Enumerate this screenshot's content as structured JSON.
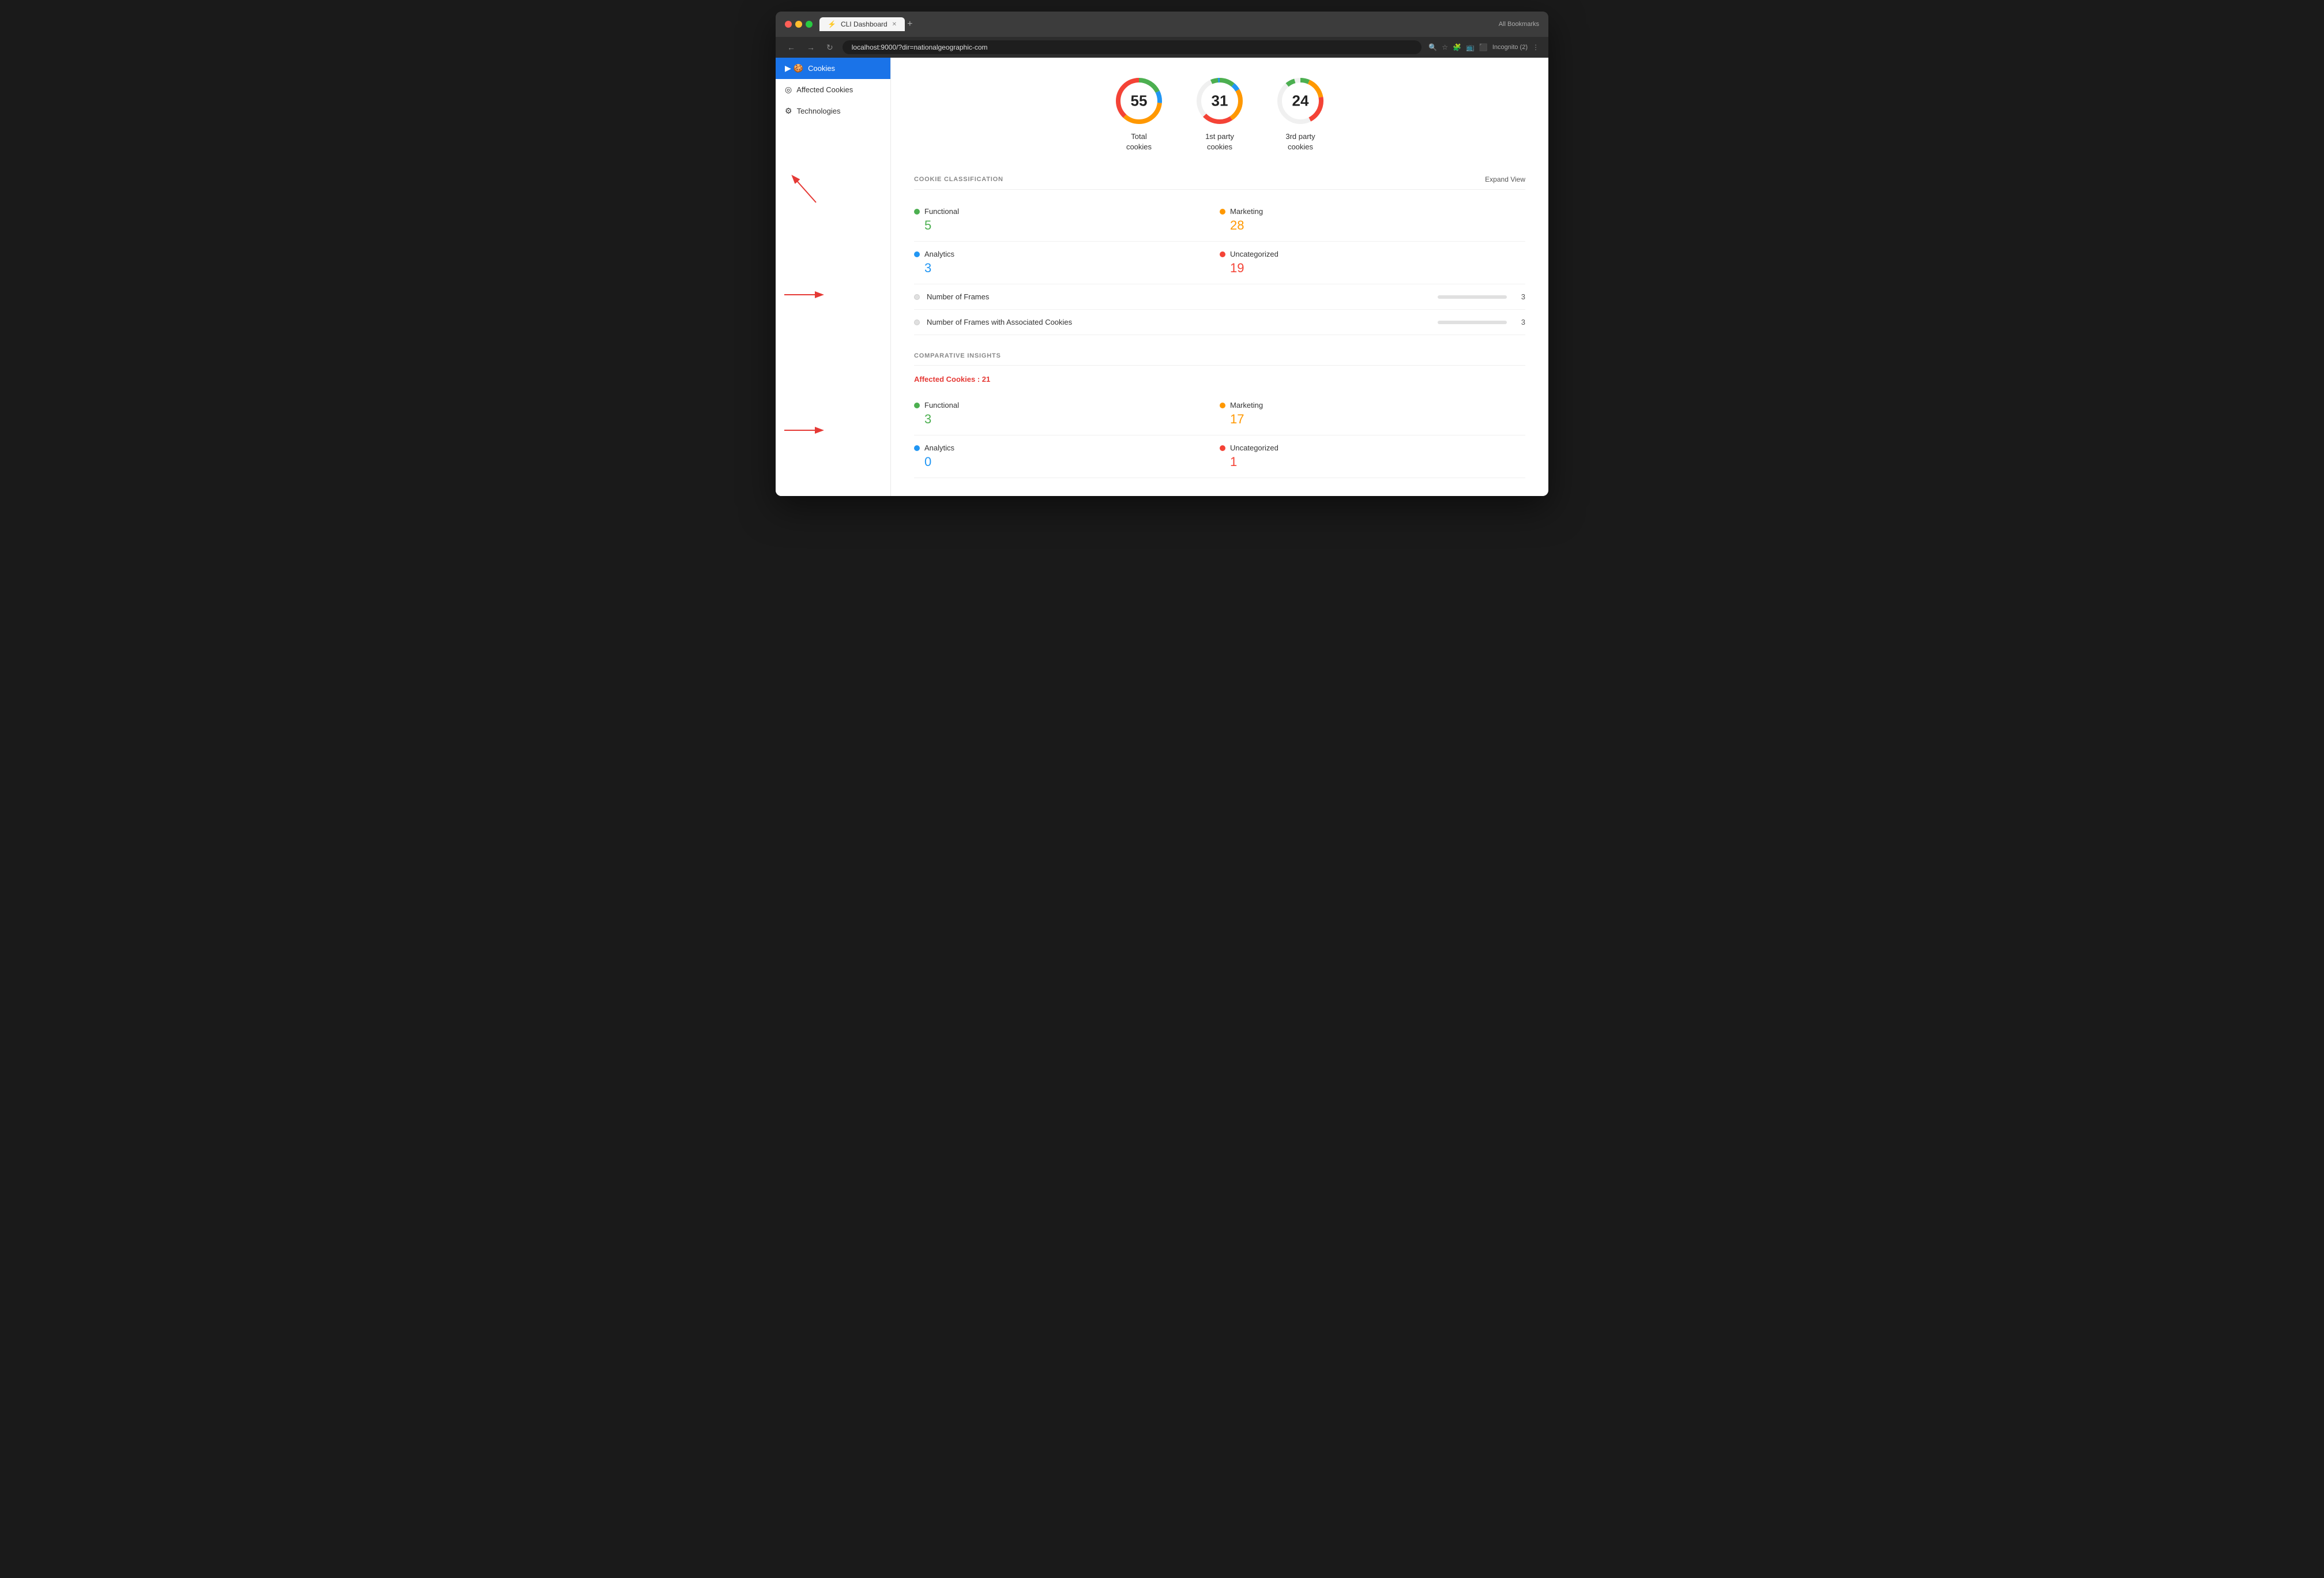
{
  "browser": {
    "tab_title": "CLI Dashboard",
    "url": "localhost:9000/?dir=nationalgeographic-com",
    "incognito_label": "Incognito (2)",
    "bookmarks_label": "All Bookmarks",
    "nav_add": "+"
  },
  "sidebar": {
    "items": [
      {
        "id": "cookies",
        "label": "Cookies",
        "icon": "🍪",
        "active": true,
        "expandable": true
      },
      {
        "id": "affected-cookies",
        "label": "Affected Cookies",
        "icon": "◎",
        "active": false
      },
      {
        "id": "technologies",
        "label": "Technologies",
        "icon": "⚙",
        "active": false
      }
    ]
  },
  "charts": [
    {
      "id": "total",
      "value": "55",
      "title": "Total\ncookies",
      "pct": 100
    },
    {
      "id": "first-party",
      "value": "31",
      "title": "1st party\ncookies",
      "pct": 56
    },
    {
      "id": "third-party",
      "value": "24",
      "title": "3rd party\ncookies",
      "pct": 44
    }
  ],
  "cookie_classification": {
    "section_title": "COOKIE CLASSIFICATION",
    "expand_label": "Expand View",
    "items": [
      {
        "id": "functional",
        "label": "Functional",
        "value": "5",
        "color_class": "dot-green",
        "val_class": "val-green"
      },
      {
        "id": "marketing",
        "label": "Marketing",
        "value": "28",
        "color_class": "dot-orange",
        "val_class": "val-orange"
      },
      {
        "id": "analytics",
        "label": "Analytics",
        "value": "3",
        "color_class": "dot-blue",
        "val_class": "val-blue"
      },
      {
        "id": "uncategorized",
        "label": "Uncategorized",
        "value": "19",
        "color_class": "dot-red",
        "val_class": "val-red"
      }
    ],
    "frames": [
      {
        "id": "num-frames",
        "label": "Number of Frames",
        "value": "3"
      },
      {
        "id": "num-frames-cookies",
        "label": "Number of Frames with Associated Cookies",
        "value": "3"
      }
    ]
  },
  "comparative_insights": {
    "section_title": "COMPARATIVE INSIGHTS",
    "affected_label": "Affected Cookies : 21",
    "items": [
      {
        "id": "functional",
        "label": "Functional",
        "value": "3",
        "color_class": "dot-green",
        "val_class": "val-green"
      },
      {
        "id": "marketing",
        "label": "Marketing",
        "value": "17",
        "color_class": "dot-orange",
        "val_class": "val-orange"
      },
      {
        "id": "analytics",
        "label": "Analytics",
        "value": "0",
        "color_class": "dot-blue",
        "val_class": "val-blue"
      },
      {
        "id": "uncategorized",
        "label": "Uncategorized",
        "value": "1",
        "color_class": "dot-red",
        "val_class": "val-red"
      }
    ]
  }
}
